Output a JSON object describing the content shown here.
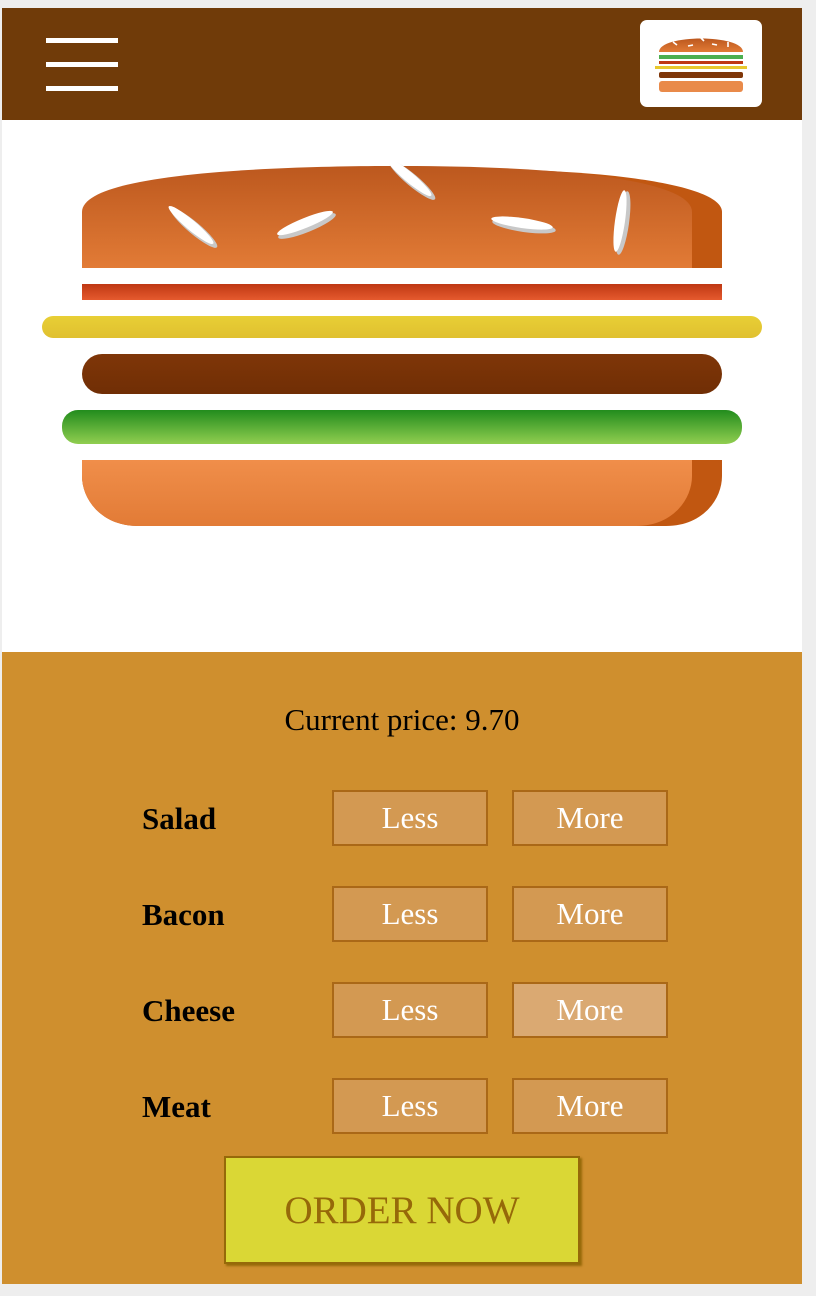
{
  "app": {
    "menu_icon": "hamburger-menu-icon",
    "logo_icon": "burger-logo-icon"
  },
  "burger": {
    "layers_top_to_bottom": [
      "bread-top",
      "bacon",
      "cheese",
      "meat",
      "salad",
      "bread-bottom"
    ],
    "colors": {
      "bread": "#E27B36",
      "bacon": "#BF3813",
      "cheese": "#E8C82D",
      "meat": "#7F3608",
      "salad": "#4CAF50",
      "seeds": "#ffffff"
    }
  },
  "controls": {
    "price_label": "Current price: 9.70",
    "items": [
      {
        "label": "Salad",
        "less": "Less",
        "more": "More"
      },
      {
        "label": "Bacon",
        "less": "Less",
        "more": "More"
      },
      {
        "label": "Cheese",
        "less": "Less",
        "more": "More"
      },
      {
        "label": "Meat",
        "less": "Less",
        "more": "More"
      }
    ],
    "order_label": "ORDER NOW"
  },
  "colors": {
    "toolbar": "#703B09",
    "controls_bg": "#CF8F2E",
    "button_bg": "#D39952",
    "button_border": "#AA6817",
    "order_bg": "#DAD735",
    "order_text": "#966909"
  }
}
